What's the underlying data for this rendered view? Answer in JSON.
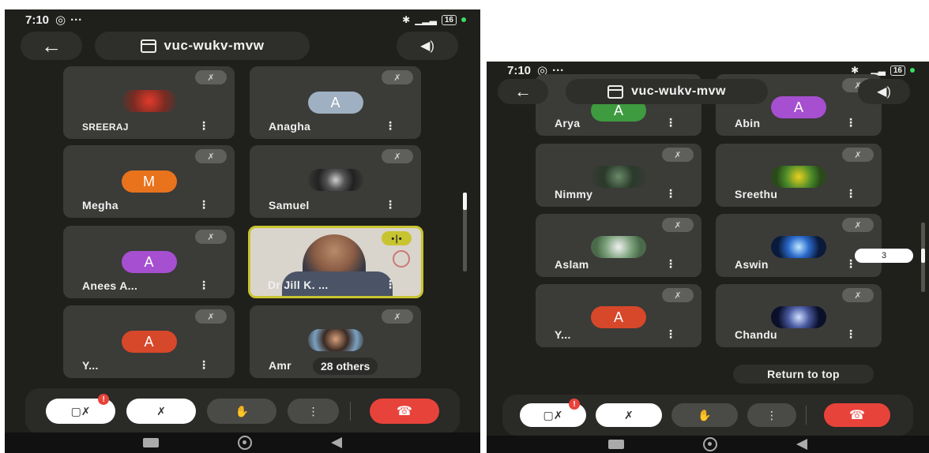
{
  "status_bar": {
    "time": "7:10",
    "extra": "···",
    "battery": "16"
  },
  "meeting": {
    "code": "vuc-wukv-mvw"
  },
  "left_screen": {
    "tiles": [
      {
        "name": "SREERAJ"
      },
      {
        "name": "Anagha",
        "initial": "A"
      },
      {
        "name": "Megha",
        "initial": "M"
      },
      {
        "name": "Samuel"
      },
      {
        "name": "Anees A...",
        "initial": "A"
      },
      {
        "name": "Dr Jill K. ..."
      },
      {
        "name": "Y...",
        "initial": "A"
      },
      {
        "name": "Amr",
        "others": "28 others"
      }
    ]
  },
  "right_screen": {
    "tiles": [
      {
        "name": "Arya",
        "initial": "A"
      },
      {
        "name": "Abin",
        "initial": "A"
      },
      {
        "name": "Nimmy"
      },
      {
        "name": "Sreethu"
      },
      {
        "name": "Aslam"
      },
      {
        "name": "Aswin"
      },
      {
        "name": "Y...",
        "initial": "A"
      },
      {
        "name": "Chandu"
      }
    ],
    "page_indicator": "3",
    "return_to_top": "Return to top"
  },
  "controls": {
    "camera_badge": "!",
    "more": "⋮"
  },
  "colors": {
    "bg": "#1f1f1c",
    "tile": "#3b3b38",
    "end_call": "#e8433a",
    "speaking_border": "#c8c430",
    "avatar_anagha": "#9fb0c2",
    "avatar_megha": "#e8731c",
    "avatar_anees": "#a64fd0",
    "avatar_y": "#d7472a",
    "avatar_arya": "#3f9b3f"
  }
}
